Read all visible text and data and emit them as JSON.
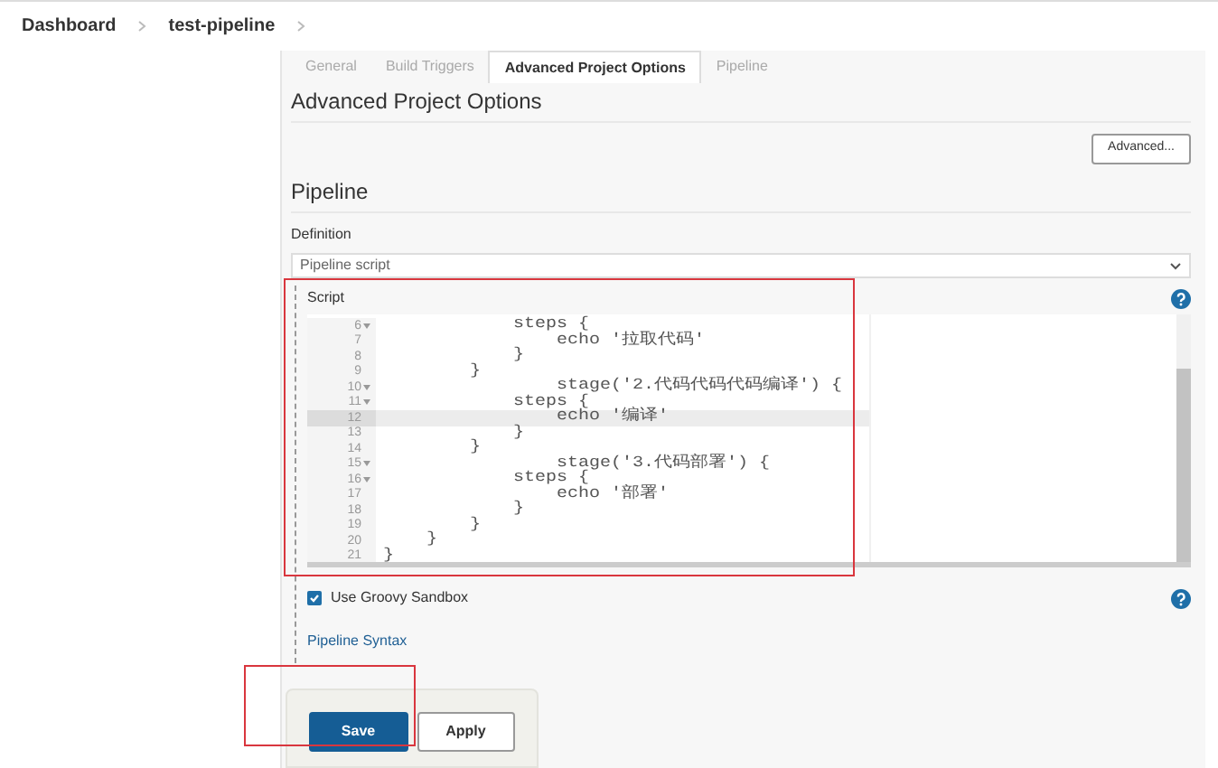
{
  "breadcrumb": [
    "Dashboard",
    "test-pipeline"
  ],
  "tabs": [
    {
      "label": "General",
      "selected": false
    },
    {
      "label": "Build Triggers",
      "selected": false
    },
    {
      "label": "Advanced Project Options",
      "selected": true
    },
    {
      "label": "Pipeline",
      "selected": false
    }
  ],
  "advanced_section": {
    "title": "Advanced Project Options",
    "button": "Advanced..."
  },
  "pipeline_section": {
    "title": "Pipeline",
    "definition_label": "Definition",
    "definition_value": "Pipeline script",
    "script_label": "Script",
    "code_lines": [
      {
        "number": "6",
        "fold": true,
        "highlighted": false,
        "text": "            steps {"
      },
      {
        "number": "7",
        "fold": false,
        "highlighted": false,
        "text": "                echo '拉取代码'"
      },
      {
        "number": "8",
        "fold": false,
        "highlighted": false,
        "text": "            }"
      },
      {
        "number": "9",
        "fold": false,
        "highlighted": false,
        "text": "        }"
      },
      {
        "number": "10",
        "fold": true,
        "highlighted": false,
        "text": "                stage('2.代码代码代码编译') {"
      },
      {
        "number": "11",
        "fold": true,
        "highlighted": false,
        "text": "            steps {"
      },
      {
        "number": "12",
        "fold": false,
        "highlighted": true,
        "text": "                echo '编译'"
      },
      {
        "number": "13",
        "fold": false,
        "highlighted": false,
        "text": "            }"
      },
      {
        "number": "14",
        "fold": false,
        "highlighted": false,
        "text": "        }"
      },
      {
        "number": "15",
        "fold": true,
        "highlighted": false,
        "text": "                stage('3.代码部署') {"
      },
      {
        "number": "16",
        "fold": true,
        "highlighted": false,
        "text": "            steps {"
      },
      {
        "number": "17",
        "fold": false,
        "highlighted": false,
        "text": "                echo '部署'"
      },
      {
        "number": "18",
        "fold": false,
        "highlighted": false,
        "text": "            }"
      },
      {
        "number": "19",
        "fold": false,
        "highlighted": false,
        "text": "        }"
      },
      {
        "number": "20",
        "fold": false,
        "highlighted": false,
        "text": "    }"
      },
      {
        "number": "21",
        "fold": false,
        "highlighted": false,
        "text": "}"
      }
    ],
    "sandbox": {
      "label": "Use Groovy Sandbox",
      "checked": true
    },
    "syntax_link": "Pipeline Syntax"
  },
  "actions": [
    {
      "label": "Save",
      "kind": "primary"
    },
    {
      "label": "Apply",
      "kind": "secondary"
    }
  ]
}
